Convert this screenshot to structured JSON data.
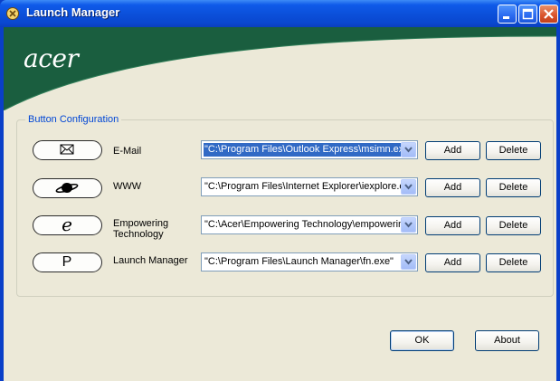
{
  "window": {
    "title": "Launch Manager",
    "icons": {
      "app": "launch-manager-icon",
      "minimize": "minimize-icon",
      "maximize": "maximize-icon",
      "close": "close-icon"
    }
  },
  "brand": {
    "logo_text": "acer",
    "banner_color": "#1a5e3f"
  },
  "config": {
    "group_label": "Button Configuration",
    "rows": [
      {
        "button_icon": "envelope-icon",
        "label": "E-Mail",
        "path": "\"C:\\Program Files\\Outlook Express\\msimn.exe\"",
        "selected": true,
        "add_label": "Add",
        "delete_label": "Delete"
      },
      {
        "button_icon": "planet-icon",
        "label": "WWW",
        "path": "\"C:\\Program Files\\Internet Explorer\\iexplore.exe\"",
        "selected": false,
        "add_label": "Add",
        "delete_label": "Delete"
      },
      {
        "button_icon": "empowering-e-icon",
        "label_line1": "Empowering",
        "label_line2": "Technology",
        "path": "\"C:\\Acer\\Empowering Technology\\empowering.exe\"",
        "selected": false,
        "add_label": "Add",
        "delete_label": "Delete"
      },
      {
        "button_icon": "p-key-icon",
        "button_letter": "P",
        "label": "Launch Manager",
        "path": "\"C:\\Program Files\\Launch Manager\\fn.exe\"",
        "selected": false,
        "add_label": "Add",
        "delete_label": "Delete"
      }
    ]
  },
  "footer": {
    "ok_label": "OK",
    "about_label": "About"
  }
}
